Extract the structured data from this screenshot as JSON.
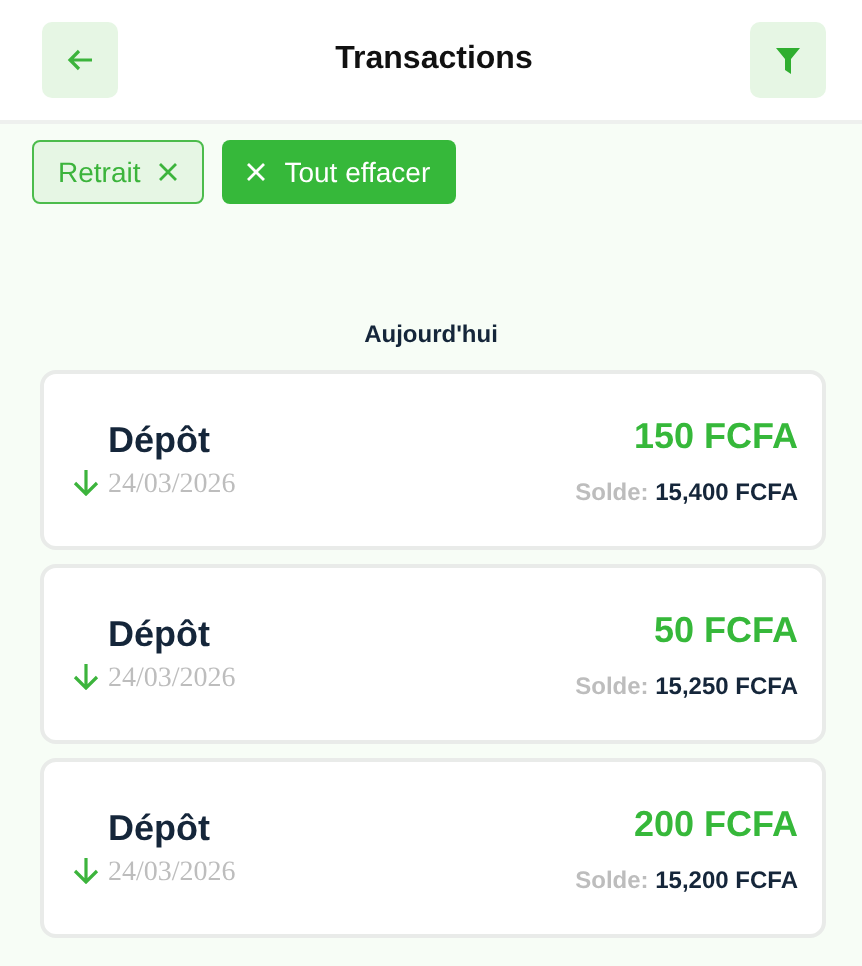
{
  "header": {
    "title": "Transactions"
  },
  "filters": [
    {
      "label": "Retrait",
      "kind": "chip"
    },
    {
      "label": "Tout effacer",
      "kind": "clear"
    }
  ],
  "section": "Aujourd'hui",
  "transactions": [
    {
      "type": "Dépôt",
      "date": "24/03/2026",
      "amount": "150 FCFA",
      "balance_label": "Solde:",
      "balance": "15,400 FCFA"
    },
    {
      "type": "Dépôt",
      "date": "24/03/2026",
      "amount": "50 FCFA",
      "balance_label": "Solde:",
      "balance": "15,250 FCFA"
    },
    {
      "type": "Dépôt",
      "date": "24/03/2026",
      "amount": "200 FCFA",
      "balance_label": "Solde:",
      "balance": "15,200 FCFA"
    }
  ]
}
